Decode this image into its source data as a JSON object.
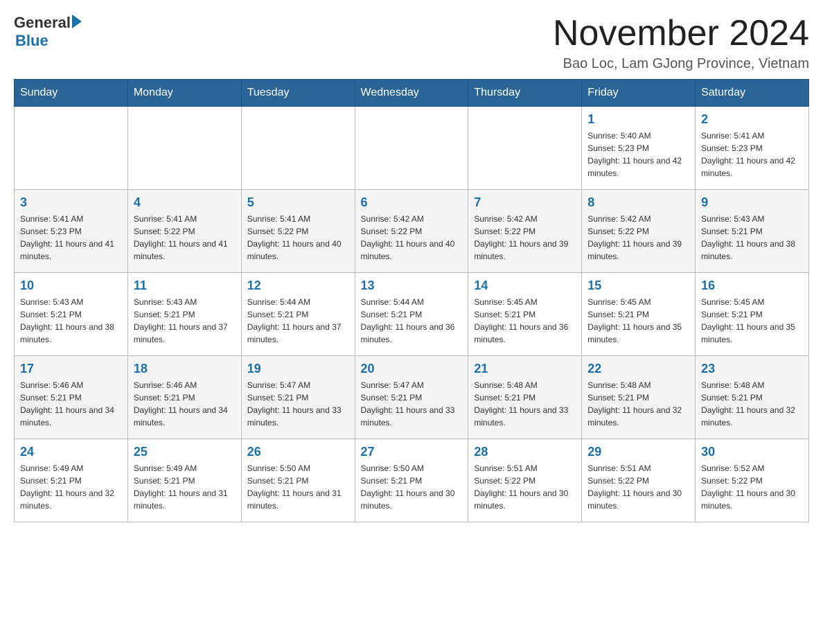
{
  "logo": {
    "text_general": "General",
    "triangle": "▶",
    "text_blue": "Blue"
  },
  "header": {
    "title": "November 2024",
    "subtitle": "Bao Loc, Lam GJong Province, Vietnam"
  },
  "weekdays": [
    "Sunday",
    "Monday",
    "Tuesday",
    "Wednesday",
    "Thursday",
    "Friday",
    "Saturday"
  ],
  "weeks": [
    {
      "days": [
        {
          "number": "",
          "info": ""
        },
        {
          "number": "",
          "info": ""
        },
        {
          "number": "",
          "info": ""
        },
        {
          "number": "",
          "info": ""
        },
        {
          "number": "",
          "info": ""
        },
        {
          "number": "1",
          "info": "Sunrise: 5:40 AM\nSunset: 5:23 PM\nDaylight: 11 hours and 42 minutes."
        },
        {
          "number": "2",
          "info": "Sunrise: 5:41 AM\nSunset: 5:23 PM\nDaylight: 11 hours and 42 minutes."
        }
      ]
    },
    {
      "days": [
        {
          "number": "3",
          "info": "Sunrise: 5:41 AM\nSunset: 5:23 PM\nDaylight: 11 hours and 41 minutes."
        },
        {
          "number": "4",
          "info": "Sunrise: 5:41 AM\nSunset: 5:22 PM\nDaylight: 11 hours and 41 minutes."
        },
        {
          "number": "5",
          "info": "Sunrise: 5:41 AM\nSunset: 5:22 PM\nDaylight: 11 hours and 40 minutes."
        },
        {
          "number": "6",
          "info": "Sunrise: 5:42 AM\nSunset: 5:22 PM\nDaylight: 11 hours and 40 minutes."
        },
        {
          "number": "7",
          "info": "Sunrise: 5:42 AM\nSunset: 5:22 PM\nDaylight: 11 hours and 39 minutes."
        },
        {
          "number": "8",
          "info": "Sunrise: 5:42 AM\nSunset: 5:22 PM\nDaylight: 11 hours and 39 minutes."
        },
        {
          "number": "9",
          "info": "Sunrise: 5:43 AM\nSunset: 5:21 PM\nDaylight: 11 hours and 38 minutes."
        }
      ]
    },
    {
      "days": [
        {
          "number": "10",
          "info": "Sunrise: 5:43 AM\nSunset: 5:21 PM\nDaylight: 11 hours and 38 minutes."
        },
        {
          "number": "11",
          "info": "Sunrise: 5:43 AM\nSunset: 5:21 PM\nDaylight: 11 hours and 37 minutes."
        },
        {
          "number": "12",
          "info": "Sunrise: 5:44 AM\nSunset: 5:21 PM\nDaylight: 11 hours and 37 minutes."
        },
        {
          "number": "13",
          "info": "Sunrise: 5:44 AM\nSunset: 5:21 PM\nDaylight: 11 hours and 36 minutes."
        },
        {
          "number": "14",
          "info": "Sunrise: 5:45 AM\nSunset: 5:21 PM\nDaylight: 11 hours and 36 minutes."
        },
        {
          "number": "15",
          "info": "Sunrise: 5:45 AM\nSunset: 5:21 PM\nDaylight: 11 hours and 35 minutes."
        },
        {
          "number": "16",
          "info": "Sunrise: 5:45 AM\nSunset: 5:21 PM\nDaylight: 11 hours and 35 minutes."
        }
      ]
    },
    {
      "days": [
        {
          "number": "17",
          "info": "Sunrise: 5:46 AM\nSunset: 5:21 PM\nDaylight: 11 hours and 34 minutes."
        },
        {
          "number": "18",
          "info": "Sunrise: 5:46 AM\nSunset: 5:21 PM\nDaylight: 11 hours and 34 minutes."
        },
        {
          "number": "19",
          "info": "Sunrise: 5:47 AM\nSunset: 5:21 PM\nDaylight: 11 hours and 33 minutes."
        },
        {
          "number": "20",
          "info": "Sunrise: 5:47 AM\nSunset: 5:21 PM\nDaylight: 11 hours and 33 minutes."
        },
        {
          "number": "21",
          "info": "Sunrise: 5:48 AM\nSunset: 5:21 PM\nDaylight: 11 hours and 33 minutes."
        },
        {
          "number": "22",
          "info": "Sunrise: 5:48 AM\nSunset: 5:21 PM\nDaylight: 11 hours and 32 minutes."
        },
        {
          "number": "23",
          "info": "Sunrise: 5:48 AM\nSunset: 5:21 PM\nDaylight: 11 hours and 32 minutes."
        }
      ]
    },
    {
      "days": [
        {
          "number": "24",
          "info": "Sunrise: 5:49 AM\nSunset: 5:21 PM\nDaylight: 11 hours and 32 minutes."
        },
        {
          "number": "25",
          "info": "Sunrise: 5:49 AM\nSunset: 5:21 PM\nDaylight: 11 hours and 31 minutes."
        },
        {
          "number": "26",
          "info": "Sunrise: 5:50 AM\nSunset: 5:21 PM\nDaylight: 11 hours and 31 minutes."
        },
        {
          "number": "27",
          "info": "Sunrise: 5:50 AM\nSunset: 5:21 PM\nDaylight: 11 hours and 30 minutes."
        },
        {
          "number": "28",
          "info": "Sunrise: 5:51 AM\nSunset: 5:22 PM\nDaylight: 11 hours and 30 minutes."
        },
        {
          "number": "29",
          "info": "Sunrise: 5:51 AM\nSunset: 5:22 PM\nDaylight: 11 hours and 30 minutes."
        },
        {
          "number": "30",
          "info": "Sunrise: 5:52 AM\nSunset: 5:22 PM\nDaylight: 11 hours and 30 minutes."
        }
      ]
    }
  ]
}
